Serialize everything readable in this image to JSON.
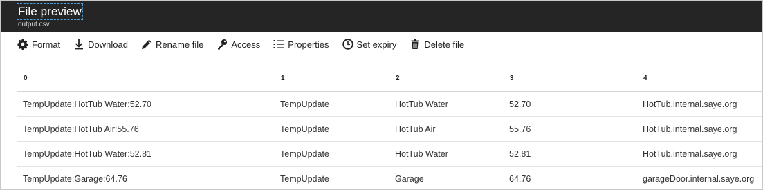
{
  "header": {
    "title": "File preview",
    "subtitle": "output.csv"
  },
  "toolbar": {
    "format": "Format",
    "download": "Download",
    "rename": "Rename file",
    "access": "Access",
    "properties": "Properties",
    "set_expiry": "Set expiry",
    "delete": "Delete file"
  },
  "icons": {
    "format": "gear-icon",
    "download": "download-icon",
    "rename": "pencil-icon",
    "access": "key-icon",
    "properties": "list-icon",
    "set_expiry": "clock-icon",
    "delete": "trash-icon"
  },
  "table": {
    "columns": [
      "0",
      "1",
      "2",
      "3",
      "4"
    ],
    "rows": [
      [
        "TempUpdate:HotTub Water:52.70",
        "TempUpdate",
        "HotTub Water",
        "52.70",
        "HotTub.internal.saye.org"
      ],
      [
        "TempUpdate:HotTub Air:55.76",
        "TempUpdate",
        "HotTub Air",
        "55.76",
        "HotTub.internal.saye.org"
      ],
      [
        "TempUpdate:HotTub Water:52.81",
        "TempUpdate",
        "HotTub Water",
        "52.81",
        "HotTub.internal.saye.org"
      ],
      [
        "TempUpdate:Garage:64.76",
        "TempUpdate",
        "Garage",
        "64.76",
        "garageDoor.internal.saye.org"
      ]
    ]
  }
}
